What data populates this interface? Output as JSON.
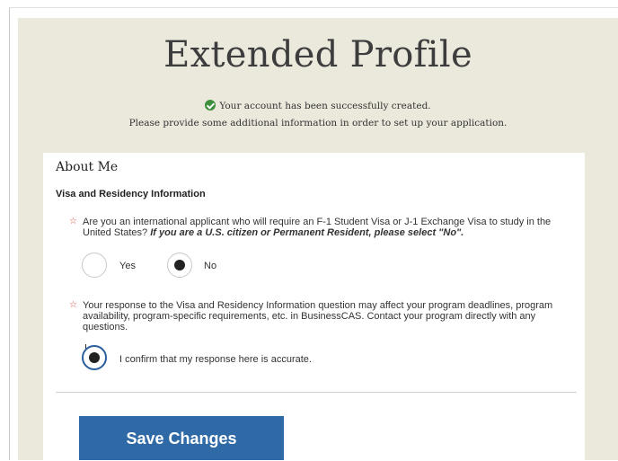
{
  "page": {
    "title": "Extended Profile",
    "success_message": "Your account has been successfully created.",
    "info_message": "Please provide some additional information in order to set up your application."
  },
  "about": {
    "section_title": "About Me",
    "subsection_title": "Visa and Residency Information",
    "question1": {
      "required_marker": "☆",
      "text": "Are you an international applicant who will require an F-1 Student Visa or J-1 Exchange Visa to study in the United States?",
      "emphasis": "If you are a U.S. citizen or Permanent Resident, please select \"No\".",
      "options": [
        {
          "label": "Yes",
          "selected": false
        },
        {
          "label": "No",
          "selected": true
        }
      ]
    },
    "question2": {
      "required_marker": "☆",
      "text": "Your response to the Visa and Residency Information question may affect your program deadlines, program availability, program-specific requirements, etc. in BusinessCAS. Contact your program directly with any questions.",
      "confirm_label": "I confirm that my response here is accurate.",
      "confirmed": true
    }
  },
  "actions": {
    "save_label": "Save Changes"
  },
  "colors": {
    "panel_bg": "#ebe8dc",
    "button_bg": "#2f6aa6",
    "success_icon": "#3c8f3c",
    "required_star": "#d24a3a"
  },
  "icons": {
    "success": "check-circle-icon"
  }
}
